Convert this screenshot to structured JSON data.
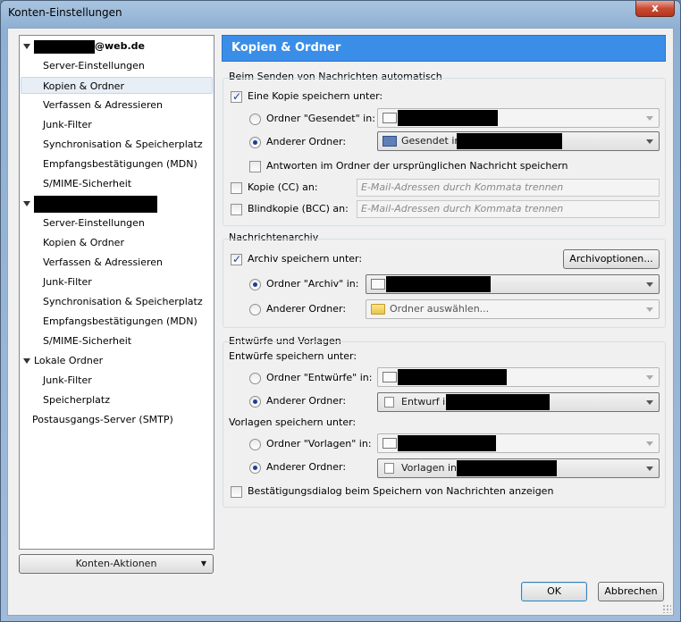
{
  "window": {
    "title": "Konten-Einstellungen",
    "close": "x"
  },
  "tree": {
    "account1": {
      "email_suffix": "@web.de"
    },
    "account1_items": [
      "Server-Einstellungen",
      "Kopien & Ordner",
      "Verfassen & Adressieren",
      "Junk-Filter",
      "Synchronisation & Speicherplatz",
      "Empfangsbestätigungen (MDN)",
      "S/MIME-Sicherheit"
    ],
    "account2_items": [
      "Server-Einstellungen",
      "Kopien & Ordner",
      "Verfassen & Adressieren",
      "Junk-Filter",
      "Synchronisation & Speicherplatz",
      "Empfangsbestätigungen (MDN)",
      "S/MIME-Sicherheit"
    ],
    "local": {
      "label": "Lokale Ordner",
      "items": [
        "Junk-Filter",
        "Speicherplatz"
      ]
    },
    "smtp": "Postausgangs-Server (SMTP)"
  },
  "konten_button": "Konten-Aktionen",
  "header": "Kopien & Ordner",
  "send": {
    "section": "Beim Senden von Nachrichten automatisch",
    "save_copy": "Eine Kopie speichern unter:",
    "folder_sent": "Ordner \"Gesendet\" in:",
    "other_folder": "Anderer Ordner:",
    "other_folder_value": "Gesendet in",
    "reply_in_folder": "Antworten im Ordner der ursprünglichen Nachricht speichern",
    "cc": "Kopie (CC) an:",
    "bcc": "Blindkopie (BCC) an:",
    "email_placeholder": "E-Mail-Adressen durch Kommata trennen"
  },
  "archive": {
    "section": "Nachrichtenarchiv",
    "save_archive": "Archiv speichern unter:",
    "options_button": "Archivoptionen...",
    "folder_archive": "Ordner \"Archiv\" in:",
    "other_folder": "Anderer Ordner:",
    "choose_folder": "Ordner auswählen..."
  },
  "drafts": {
    "section": "Entwürfe und Vorlagen",
    "drafts_label": "Entwürfe speichern unter:",
    "folder_drafts": "Ordner \"Entwürfe\" in:",
    "other_folder": "Anderer Ordner:",
    "draft_value": "Entwurf in",
    "templates_label": "Vorlagen speichern unter:",
    "folder_templates": "Ordner \"Vorlagen\" in:",
    "other_folder2": "Anderer Ordner:",
    "template_value": "Vorlagen in",
    "confirm_dialog": "Bestätigungsdialog beim Speichern von Nachrichten anzeigen"
  },
  "buttons": {
    "ok": "OK",
    "cancel": "Abbrechen"
  }
}
